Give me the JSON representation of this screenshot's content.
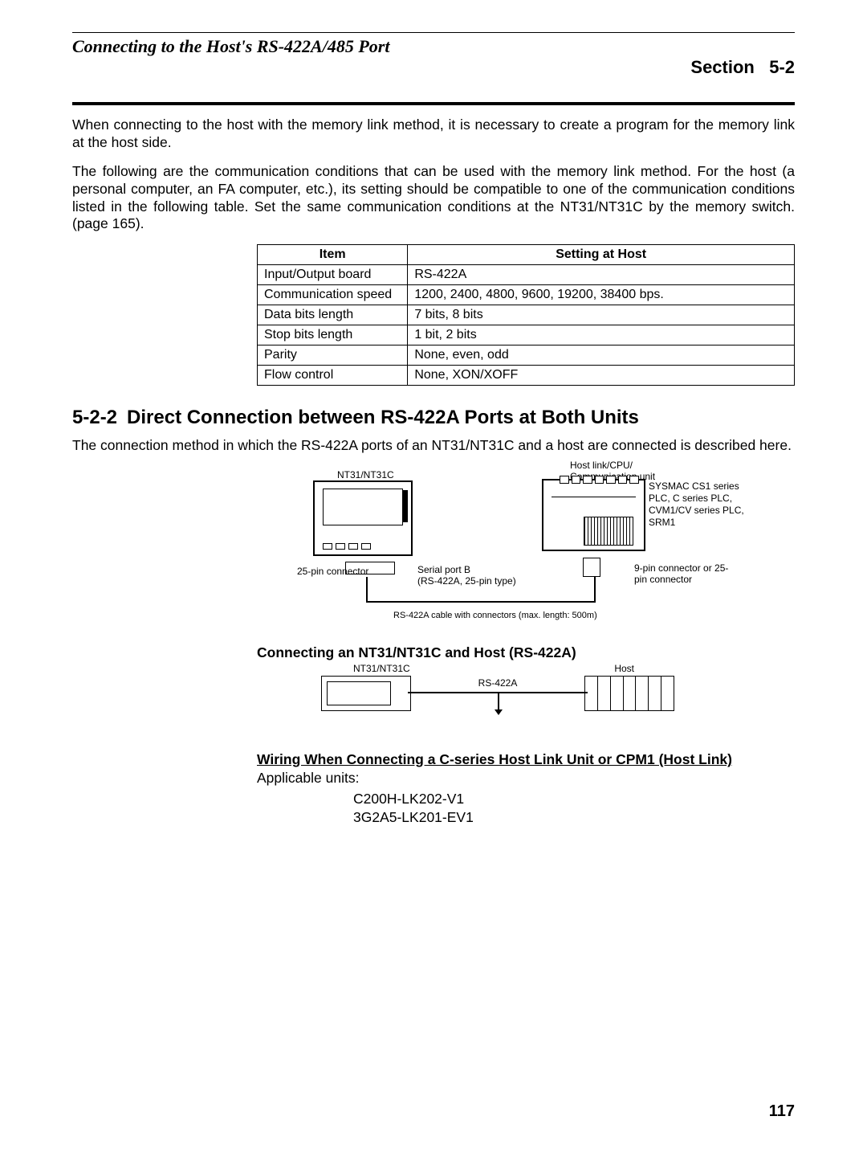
{
  "header": {
    "left": "Connecting to the Host's RS-422A/485 Port",
    "section_word": "Section",
    "section_num": "5-2"
  },
  "paragraphs": {
    "p1": "When connecting to the host with the memory link method, it is necessary to create a program for the memory link at the host side.",
    "p2": "The following are the communication conditions that can be used with the memory link method. For the host (a personal computer, an FA computer, etc.), its setting should be compatible to one of the communication conditions listed in the following table. Set the same communication conditions at the NT31/NT31C by the memory switch. (page 165).",
    "p3": "The connection method in which the RS-422A ports of an NT31/NT31C and a host are connected is described here.",
    "applicable": "Applicable units:"
  },
  "settings_table": {
    "headers": [
      "Item",
      "Setting at Host"
    ],
    "rows": [
      [
        "Input/Output board",
        "RS-422A"
      ],
      [
        "Communication speed",
        "1200, 2400, 4800, 9600, 19200, 38400 bps."
      ],
      [
        "Data bits length",
        "7 bits, 8 bits"
      ],
      [
        "Stop bits length",
        "1 bit, 2 bits"
      ],
      [
        "Parity",
        "None, even, odd"
      ],
      [
        "Flow control",
        "None, XON/XOFF"
      ]
    ]
  },
  "section": {
    "num": "5-2-2",
    "title": "Direct Connection between RS-422A Ports at Both Units"
  },
  "subheadings": {
    "s1": "Connecting an NT31/NT31C and Host (RS-422A)",
    "s2": "Wiring When Connecting a C-series Host Link Unit or CPM1 (Host Link)"
  },
  "units": {
    "u1": "C200H-LK202-V1",
    "u2": "3G2A5-LK201-EV1"
  },
  "diagram1": {
    "nt_label": "NT31/NT31C",
    "conn_label": "25-pin connector",
    "serial_b_l1": "Serial port B",
    "serial_b_l2": "(RS-422A, 25-pin type)",
    "host_label": "Host link/CPU/ Communication unit",
    "host_side": "SYSMAC CS1 series PLC, C series PLC, CVM1/CV series PLC, SRM1",
    "host_conn": "9-pin connector or 25-pin connector",
    "cable_caption": "RS-422A cable with connectors (max. length: 500m)"
  },
  "diagram2": {
    "left": "NT31/NT31C",
    "right": "Host",
    "cable": "RS-422A"
  },
  "page_number": "117"
}
